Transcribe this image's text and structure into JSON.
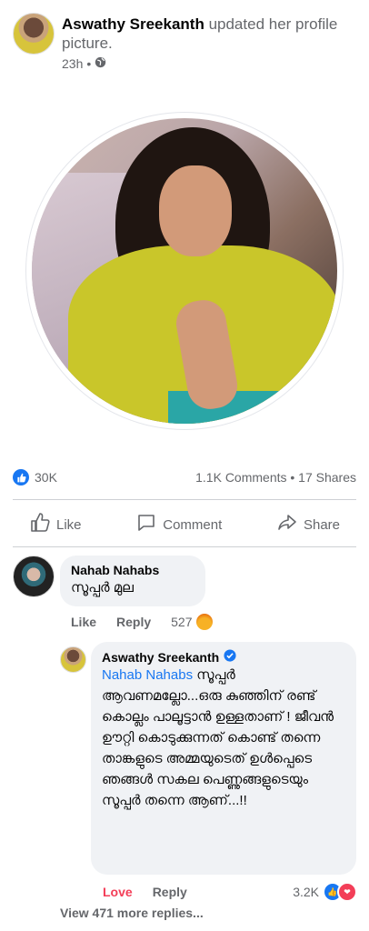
{
  "post": {
    "author": "Aswathy Sreekanth",
    "action": " updated her profile picture.",
    "time": "23h",
    "privacy_icon": "globe-icon"
  },
  "stats": {
    "reactions": "30K",
    "comments_shares": "1.1K Comments • 17 Shares"
  },
  "actions": {
    "like": "Like",
    "comment": "Comment",
    "share": "Share"
  },
  "comments": [
    {
      "name": "Nahab Nahabs",
      "text": "സൂപ്പർ മുല",
      "like_label": "Like",
      "reply_label": "Reply",
      "reaction_count": "527",
      "reaction_icon": "angry-icon"
    }
  ],
  "reply": {
    "name": "Aswathy Sreekanth",
    "mention": "Nahab Nahabs",
    "text": " സൂപ്പർ ആവണമല്ലോ...ഒരു കുഞ്ഞിന് രണ്ട് കൊല്ലം പാലൂട്ടാൻ ഉള്ളതാണ് ! ജീവൻ ഊറ്റി കൊടുക്കുന്നത് കൊണ്ട് തന്നെ താങ്കളുടെ അമ്മയുടെത് ഉൾപ്പെടെ ഞങ്ങൾ സകല പെണ്ണുങ്ങളുടെയും സൂപ്പർ തന്നെ ആണ്...!!",
    "love_label": "Love",
    "reply_label": "Reply",
    "reaction_count": "3.2K",
    "verified_icon": "verified-badge-icon"
  },
  "view_more": "View 471 more replies...",
  "colors": {
    "brand_blue": "#1877f2",
    "love_red": "#f33e58",
    "muted": "#65676b",
    "bubble": "#f0f2f5"
  }
}
